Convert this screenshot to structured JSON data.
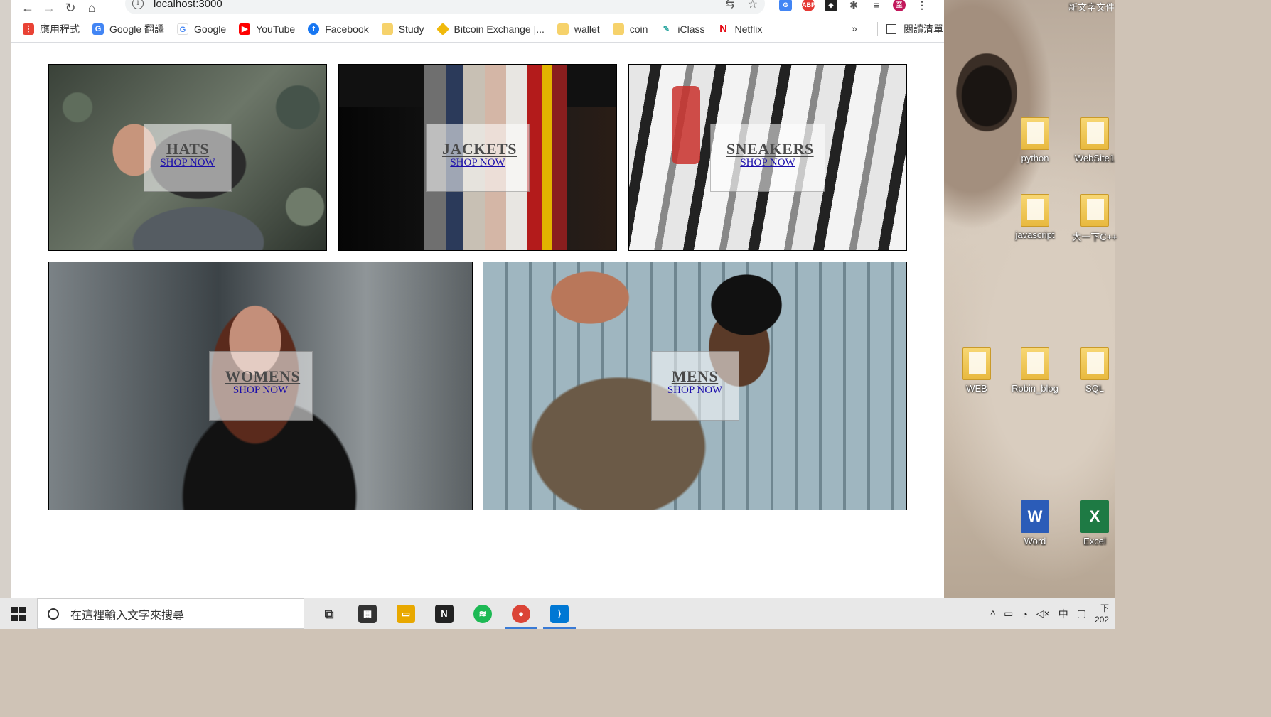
{
  "browser": {
    "url": "localhost:3000",
    "bookmarks": [
      {
        "label": "應用程式",
        "icon": "apps-grid-icon",
        "color": "#e94235"
      },
      {
        "label": "Google 翻譯",
        "icon": "google-translate-icon",
        "color": "#4285f4"
      },
      {
        "label": "Google",
        "icon": "google-icon",
        "color": "#4285f4"
      },
      {
        "label": "YouTube",
        "icon": "youtube-icon",
        "color": "#ff0000"
      },
      {
        "label": "Facebook",
        "icon": "facebook-icon",
        "color": "#1877f2"
      },
      {
        "label": "Study",
        "icon": "folder-icon",
        "color": "#f6d26b"
      },
      {
        "label": "Bitcoin Exchange |...",
        "icon": "binance-icon",
        "color": "#f0b90b"
      },
      {
        "label": "wallet",
        "icon": "folder-icon",
        "color": "#f6d26b"
      },
      {
        "label": "coin",
        "icon": "folder-icon",
        "color": "#f6d26b"
      },
      {
        "label": "iClass",
        "icon": "iclass-icon",
        "color": "#2aa6a0"
      },
      {
        "label": "Netflix",
        "icon": "netflix-icon",
        "color": "#e50914"
      }
    ],
    "more_label": "»",
    "reading_list_label": "閱讀清單"
  },
  "directory": {
    "sections": [
      {
        "title": "HATS",
        "link": "SHOP NOW"
      },
      {
        "title": "JACKETS",
        "link": "SHOP NOW"
      },
      {
        "title": "SNEAKERS",
        "link": "SHOP NOW"
      },
      {
        "title": "WOMENS",
        "link": "SHOP NOW"
      },
      {
        "title": "MENS",
        "link": "SHOP NOW"
      }
    ]
  },
  "desktop": {
    "top_text": "新文字文件",
    "icons": [
      {
        "label": "python",
        "type": "folder"
      },
      {
        "label": "WebSite1",
        "type": "folder"
      },
      {
        "label": "javascript",
        "type": "folder"
      },
      {
        "label": "大一下C++",
        "type": "folder"
      },
      {
        "label": "WEB",
        "type": "folder"
      },
      {
        "label": "Robin_blog",
        "type": "folder"
      },
      {
        "label": "SQL",
        "type": "folder"
      },
      {
        "label": "Word",
        "type": "word"
      },
      {
        "label": "Excel",
        "type": "excel"
      }
    ]
  },
  "taskbar": {
    "search_placeholder": "在這裡輸入文字來搜尋",
    "apps": [
      {
        "name": "task-view",
        "color": "#444"
      },
      {
        "name": "store",
        "color": "#333"
      },
      {
        "name": "file-explorer",
        "color": "#e8a800"
      },
      {
        "name": "notion",
        "color": "#222"
      },
      {
        "name": "spotify",
        "color": "#1db954"
      },
      {
        "name": "chrome",
        "color": "#db4437"
      },
      {
        "name": "vscode",
        "color": "#0078d4"
      }
    ],
    "ime": "中",
    "clock": "下\n202"
  }
}
